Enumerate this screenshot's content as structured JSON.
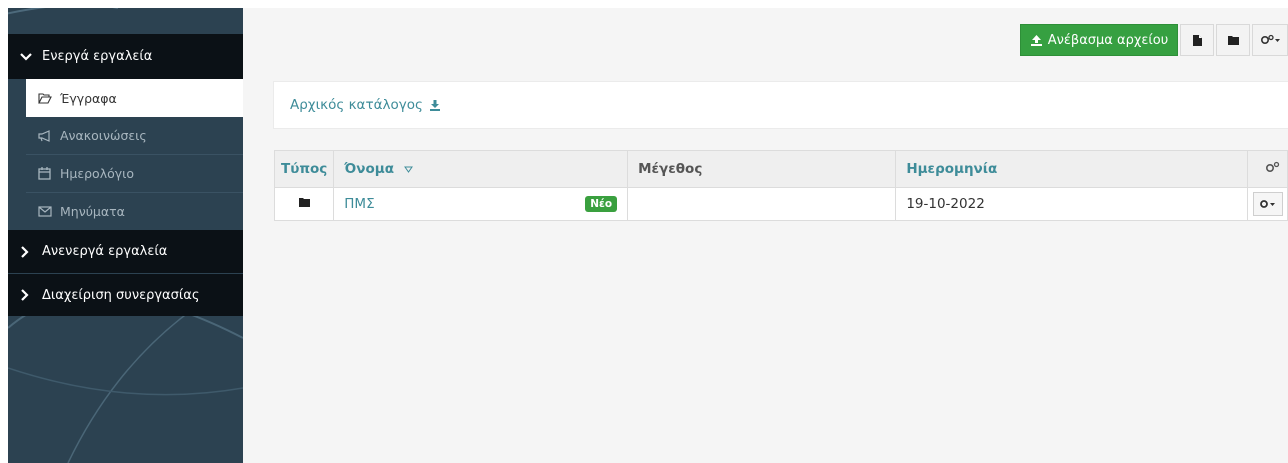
{
  "sidebar": {
    "active_tools_label": "Ενεργά εργαλεία",
    "items": [
      {
        "label": "Έγγραφα",
        "icon": "folder-open-icon"
      },
      {
        "label": "Ανακοινώσεις",
        "icon": "bullhorn-icon"
      },
      {
        "label": "Ημερολόγιο",
        "icon": "calendar-icon"
      },
      {
        "label": "Μηνύματα",
        "icon": "envelope-icon"
      }
    ],
    "inactive_tools_label": "Ανενεργά εργαλεία",
    "manage_label": "Διαχείριση συνεργασίας"
  },
  "toolbar": {
    "upload_label": "Ανέβασμα αρχείου"
  },
  "breadcrumb": {
    "root_label": "Αρχικός κατάλογος"
  },
  "table": {
    "headers": {
      "type": "Τύπος",
      "name": "Όνομα",
      "size": "Μέγεθος",
      "date": "Ημερομηνία"
    },
    "rows": [
      {
        "type_icon": "folder-icon",
        "name": "ΠΜΣ",
        "badge": "Νέο",
        "size": "",
        "date": "19-10-2022"
      }
    ]
  },
  "colors": {
    "sidebar_bg": "#2c4251",
    "section_bg": "#0b1116",
    "primary_green": "#36a041",
    "link_teal": "#3e8c99"
  }
}
